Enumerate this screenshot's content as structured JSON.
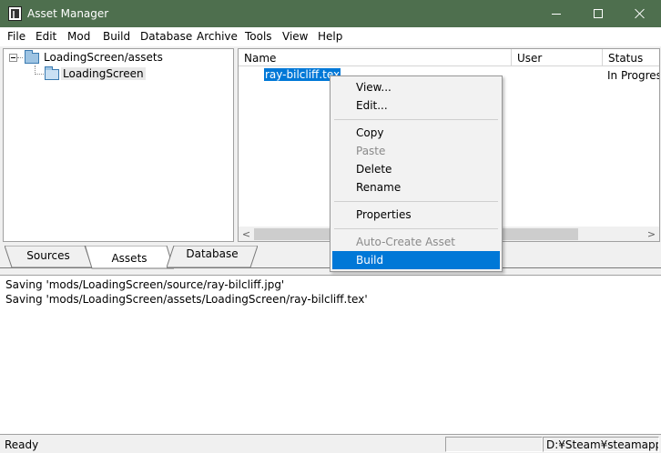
{
  "window": {
    "title": "Asset Manager"
  },
  "menubar": [
    "File",
    "Edit",
    "Mod",
    "Build",
    "Database",
    "Archive",
    "Tools",
    "View",
    "Help"
  ],
  "tree": {
    "root_label": "LoadingScreen/assets",
    "child_label": "LoadingScreen"
  },
  "list": {
    "columns": [
      "Name",
      "User",
      "Status"
    ],
    "rows": [
      {
        "name": "ray-bilcliff.tex",
        "user": "",
        "status": "In Progress"
      }
    ]
  },
  "tabs": [
    "Sources",
    "Assets",
    "Database"
  ],
  "active_tab": "Assets",
  "log": [
    "Saving 'mods/LoadingScreen/source/ray-bilcliff.jpg'",
    "Saving 'mods/LoadingScreen/assets/LoadingScreen/ray-bilcliff.tex'"
  ],
  "status": {
    "text": "Ready",
    "path": "D:¥Steam¥steamapp"
  },
  "context_menu": {
    "items": [
      {
        "label": "View...",
        "enabled": true
      },
      {
        "label": "Edit...",
        "enabled": true
      },
      {
        "label": "Copy",
        "enabled": true
      },
      {
        "label": "Paste",
        "enabled": false
      },
      {
        "label": "Delete",
        "enabled": true
      },
      {
        "label": "Rename",
        "enabled": true
      },
      {
        "label": "Properties",
        "enabled": true
      },
      {
        "label": "Auto-Create Asset",
        "enabled": false
      },
      {
        "label": "Build",
        "enabled": true,
        "highlighted": true
      }
    ]
  },
  "colors": {
    "titlebar": "#4e6f4e",
    "selection": "#0078d7"
  }
}
